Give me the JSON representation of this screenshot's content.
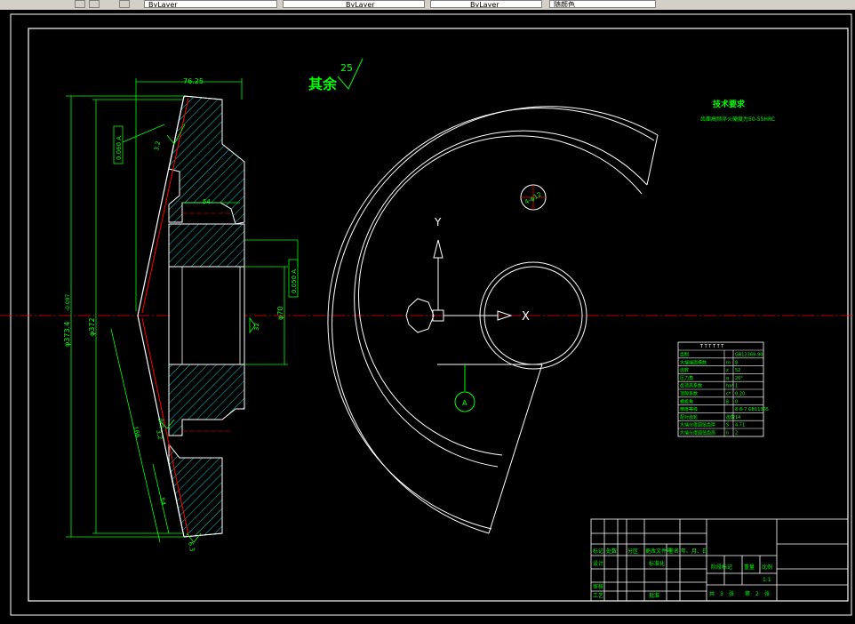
{
  "toolbar": {
    "layer_control": "ByLayer",
    "linetype": "ByLayer",
    "lineweight": "ByLayer",
    "plot_style": "随颜色"
  },
  "colors": {
    "background": "#000000",
    "geometry": "#ffffff",
    "dimension": "#00ff00",
    "centerline": "#ff0000",
    "annotation": "#00ff00",
    "hatch": "#00ffff",
    "titleblock": "#ffffff"
  },
  "drawing": {
    "roughness_label": "其余",
    "roughness_value": "25",
    "dimensions": {
      "top_width": "76.25",
      "hub_width": "54",
      "dia_outer": "φ373.4",
      "dia_outer_tol": "-0.097",
      "dia_cone": "φ372",
      "dia_bore": "φ70",
      "bore_tol": "32",
      "cone_length": "166",
      "cone_length_2": "54",
      "angle_1": "3.2",
      "angle_2": "3.2",
      "angle_3": "6.3",
      "small_dim": "120"
    },
    "tolerance_frames": {
      "runout_1": "0.060 A",
      "runout_2": "0.050 A"
    },
    "datum_label": "A",
    "bolt_hole_label": "4-φ12",
    "axis_y": "Y",
    "axis_x": "X"
  },
  "tech_requirements": {
    "title": "技术要求",
    "line1": "齿面高频淬火硬度为50-55HRC"
  },
  "gear_table": {
    "header": "T T T T T T",
    "rows": [
      {
        "label": "齿制",
        "symbol": "",
        "value": "GB12369-90"
      },
      {
        "label": "大端端面模数",
        "symbol": "m",
        "value": "8"
      },
      {
        "label": "齿数",
        "symbol": "z",
        "value": "52"
      },
      {
        "label": "压力角",
        "symbol": "α",
        "value": "20°"
      },
      {
        "label": "齿顶高系数",
        "symbol": "ha*",
        "value": "1"
      },
      {
        "label": "顶隙系数",
        "symbol": "c*",
        "value": "0.20"
      },
      {
        "label": "螺旋角",
        "symbol": "β",
        "value": "0"
      },
      {
        "label": "精度等级",
        "symbol": "",
        "value": "8-8-7 GB11365"
      },
      {
        "label": "配对齿轮",
        "symbol": "齿数",
        "value": "14"
      },
      {
        "label": "大端分度圆弦齿厚",
        "symbol": "S",
        "value": "4.71"
      },
      {
        "label": "大端分度圆弦齿高",
        "symbol": "h",
        "value": "2"
      }
    ]
  },
  "title_block": {
    "row1": [
      "标记",
      "处数",
      "分区",
      "更改文件号",
      "签名",
      "年、月、日"
    ],
    "row2": [
      "设计",
      "",
      "",
      "标准化",
      ""
    ],
    "row3": [
      "审核"
    ],
    "row4": [
      "工艺",
      "",
      "",
      "批准"
    ],
    "stage_label": "阶段标记",
    "weight_label": "重量",
    "scale_label": "比例",
    "scale_value": "1:1",
    "sheets": [
      "共",
      "张",
      "第",
      "张"
    ],
    "sheets_count": "3",
    "sheet_no": "2"
  }
}
